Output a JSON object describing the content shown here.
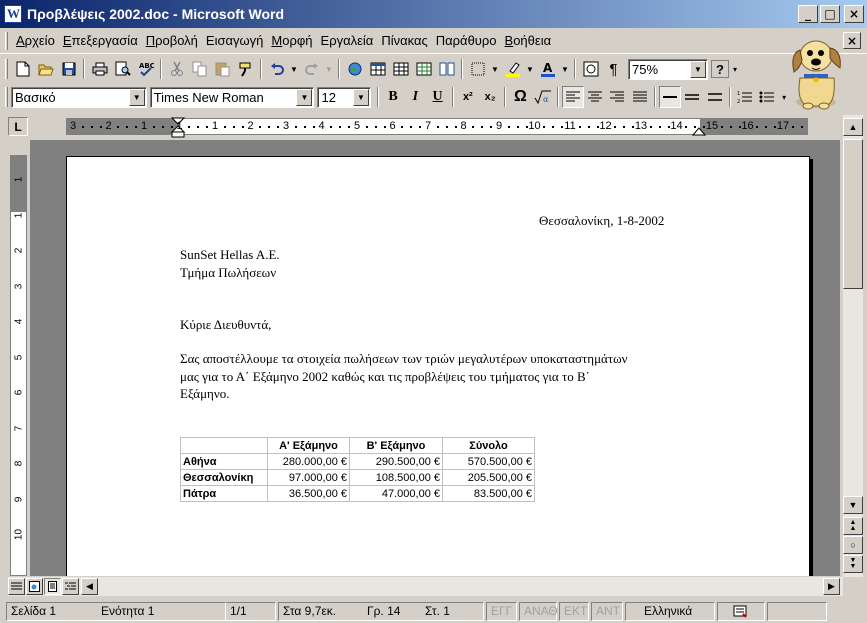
{
  "window": {
    "title": "Προβλέψεις 2002.doc - Microsoft Word",
    "min_glyph": "_",
    "max_glyph": "□",
    "close_glyph": "×"
  },
  "menu": {
    "items": [
      {
        "label": "Αρχείο",
        "key": "Α",
        "rest": "ρχείο"
      },
      {
        "label": "Επεξεργασία",
        "key": "Ε",
        "rest": "πεξεργασία"
      },
      {
        "label": "Προβολή",
        "key": "Π",
        "rest": "ροβολή",
        "underline_first": false
      },
      {
        "label": "Εισαγωγή",
        "key": "",
        "rest": "Εισαγωγή"
      },
      {
        "label": "Μορφή",
        "key": "Μ",
        "rest": "ορφή"
      },
      {
        "label": "Εργαλεία",
        "key": "",
        "rest": "Εργαλεία"
      },
      {
        "label": "Πίνακας",
        "key": "",
        "rest": "Πίνακας"
      },
      {
        "label": "Παράθυρο",
        "key": "",
        "rest": "Παράθυρο"
      },
      {
        "label": "Βοήθεια",
        "key": "Β",
        "rest": "οήθεια"
      }
    ],
    "doc_close_glyph": "×"
  },
  "toolbar_standard": {
    "zoom": "75%",
    "help_glyph": "?"
  },
  "toolbar_formatting": {
    "style": "Βασικό",
    "font": "Times New Roman",
    "size": "12",
    "bold": "B",
    "italic": "I",
    "underline": "U",
    "superscript": "x²",
    "subscript": "x₂",
    "omega": "Ω"
  },
  "ruler": {
    "tab_selector": "L",
    "h_numbers": [
      "3",
      "2",
      "1",
      "1",
      "1",
      "2",
      "3",
      "4",
      "5",
      "6",
      "7",
      "8",
      "9",
      "10",
      "11",
      "12",
      "13",
      "14",
      "15",
      "16",
      "17"
    ],
    "v_numbers": [
      "1",
      "1",
      "2",
      "3",
      "4",
      "5",
      "6",
      "7",
      "8",
      "9",
      "10"
    ]
  },
  "document": {
    "date_line": "Θεσσαλονίκη, 1-8-2002",
    "company": "SunSet Hellas A.E.",
    "department": "Τμήμα Πωλήσεων",
    "greeting": "Κύριε Διευθυντά,",
    "body_lines": [
      "Σας αποστέλλουμε τα στοιχεία πωλήσεων των τριών μεγαλυτέρων υποκαταστημάτων",
      "μας για το Α΄ Εξάμηνο 2002 καθώς και τις προβλέψεις του τμήματος για το Β΄",
      "Εξάμηνο."
    ],
    "table": {
      "headers": [
        "",
        "Α' Εξάμηνο",
        "Β' Εξάμηνο",
        "Σύνολο"
      ],
      "rows": [
        [
          "Αθήνα",
          "280.000,00 €",
          "290.500,00 €",
          "570.500,00 €"
        ],
        [
          "Θεσσαλονίκη",
          "97.000,00 €",
          "108.500,00 €",
          "205.500,00 €"
        ],
        [
          "Πάτρα",
          "36.500,00 €",
          "47.000,00 €",
          "83.500,00 €"
        ]
      ]
    }
  },
  "statusbar": {
    "page": "Σελίδα 1",
    "section": "Ενότητα 1",
    "page_of": "1/1",
    "at": "Στα 9,7εκ.",
    "line": "Γρ. 14",
    "col": "Στ. 1",
    "rec": "ΕΓΓ",
    "trk": "ΑΝΑΘ",
    "ext": "ΕΚΤ",
    "ovr": "ΑΝΤ",
    "language": "Ελληνικά"
  }
}
